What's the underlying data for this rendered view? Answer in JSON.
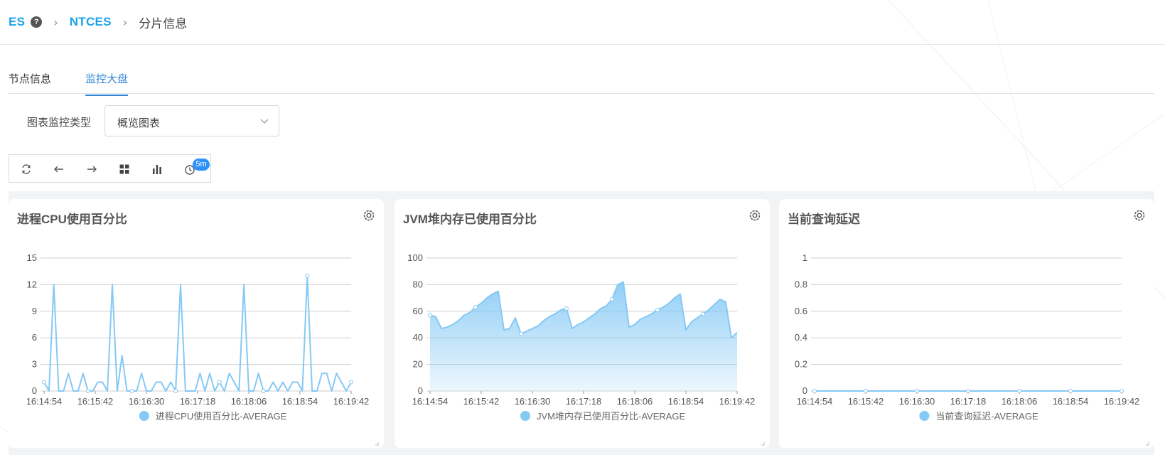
{
  "breadcrumb": {
    "root": "ES",
    "cluster": "NTCES",
    "current": "分片信息"
  },
  "tabs": [
    {
      "label": "节点信息"
    },
    {
      "label": "监控大盘",
      "active": true
    }
  ],
  "filter": {
    "label": "图表监控类型",
    "value": "概览图表"
  },
  "toolbar": {
    "badge": "5m"
  },
  "colors": {
    "accent": "#2f86d6",
    "series": "#85c9f5",
    "link": "#1aa3e8"
  },
  "chart_data": [
    {
      "type": "area",
      "title": "进程CPU使用百分比",
      "x": [
        "16:14:54",
        "16:15:42",
        "16:16:30",
        "16:17:18",
        "16:18:06",
        "16:18:54",
        "16:19:42"
      ],
      "yticks": [
        "0",
        "3",
        "6",
        "9",
        "12",
        "15"
      ],
      "ylim": [
        0,
        15
      ],
      "fill": false,
      "series": [
        {
          "name": "进程CPU使用百分比-AVERAGE",
          "values": [
            1,
            0,
            12,
            0,
            0,
            2,
            0,
            0,
            2,
            0,
            0,
            1,
            1,
            0,
            12,
            0,
            4,
            0,
            0,
            0,
            2,
            0,
            0,
            1,
            1,
            0,
            1,
            0,
            12,
            0,
            0,
            0,
            2,
            0,
            2,
            0,
            1,
            0,
            2,
            1,
            0,
            12,
            0,
            0,
            2,
            0,
            0,
            1,
            0,
            1,
            0,
            1,
            1,
            0,
            13,
            0,
            0,
            2,
            2,
            0,
            2,
            1,
            0,
            1
          ]
        }
      ]
    },
    {
      "type": "area",
      "title": "JVM堆内存已使用百分比",
      "x": [
        "16:14:54",
        "16:15:42",
        "16:16:30",
        "16:17:18",
        "16:18:06",
        "16:18:54",
        "16:19:42"
      ],
      "yticks": [
        "0",
        "20",
        "40",
        "60",
        "80",
        "100"
      ],
      "ylim": [
        0,
        100
      ],
      "fill": true,
      "series": [
        {
          "name": "JVM堆内存已使用百分比-AVERAGE",
          "values": [
            57,
            56,
            47,
            48,
            50,
            53,
            57,
            59,
            63,
            66,
            70,
            73,
            75,
            46,
            47,
            55,
            43,
            45,
            47,
            49,
            53,
            56,
            58,
            61,
            62,
            47,
            50,
            52,
            55,
            58,
            62,
            64,
            69,
            80,
            82,
            48,
            50,
            54,
            56,
            58,
            61,
            63,
            66,
            70,
            73,
            46,
            52,
            55,
            58,
            61,
            65,
            69,
            67,
            40,
            44
          ]
        }
      ]
    },
    {
      "type": "line",
      "title": "当前查询延迟",
      "x": [
        "16:14:54",
        "16:15:42",
        "16:16:30",
        "16:17:18",
        "16:18:06",
        "16:18:54",
        "16:19:42"
      ],
      "yticks": [
        "0",
        "0.2",
        "0.4",
        "0.6",
        "0.8",
        "1"
      ],
      "ylim": [
        0,
        1
      ],
      "fill": false,
      "series": [
        {
          "name": "当前查询延迟-AVERAGE",
          "values": [
            0,
            0,
            0,
            0,
            0,
            0,
            0
          ]
        }
      ]
    }
  ]
}
